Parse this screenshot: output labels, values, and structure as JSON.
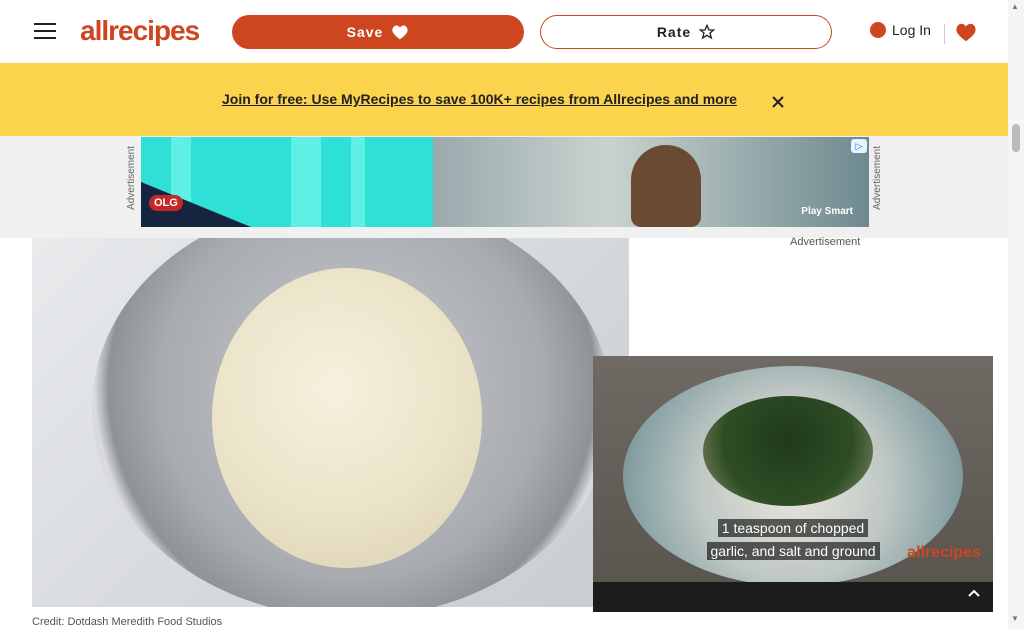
{
  "header": {
    "logo_text": "allrecipes",
    "save_label": "Save",
    "rate_label": "Rate",
    "login_label": "Log In"
  },
  "banner": {
    "link_text": "Join for free: Use MyRecipes to save 100K+ recipes from Allrecipes and more"
  },
  "ad": {
    "side_label": "Advertisement",
    "caption": "Advertisement",
    "brand_text": "OLG",
    "play_text": "Play Smart"
  },
  "hero": {
    "credit": "Credit: Dotdash Meredith Food Studios"
  },
  "video": {
    "caption_line1": "1 teaspoon of chopped",
    "caption_line2": "garlic, and salt and ground",
    "logo_text": "allrecipes"
  },
  "colors": {
    "brand": "#ce4620",
    "banner_bg": "#fcd34d"
  }
}
